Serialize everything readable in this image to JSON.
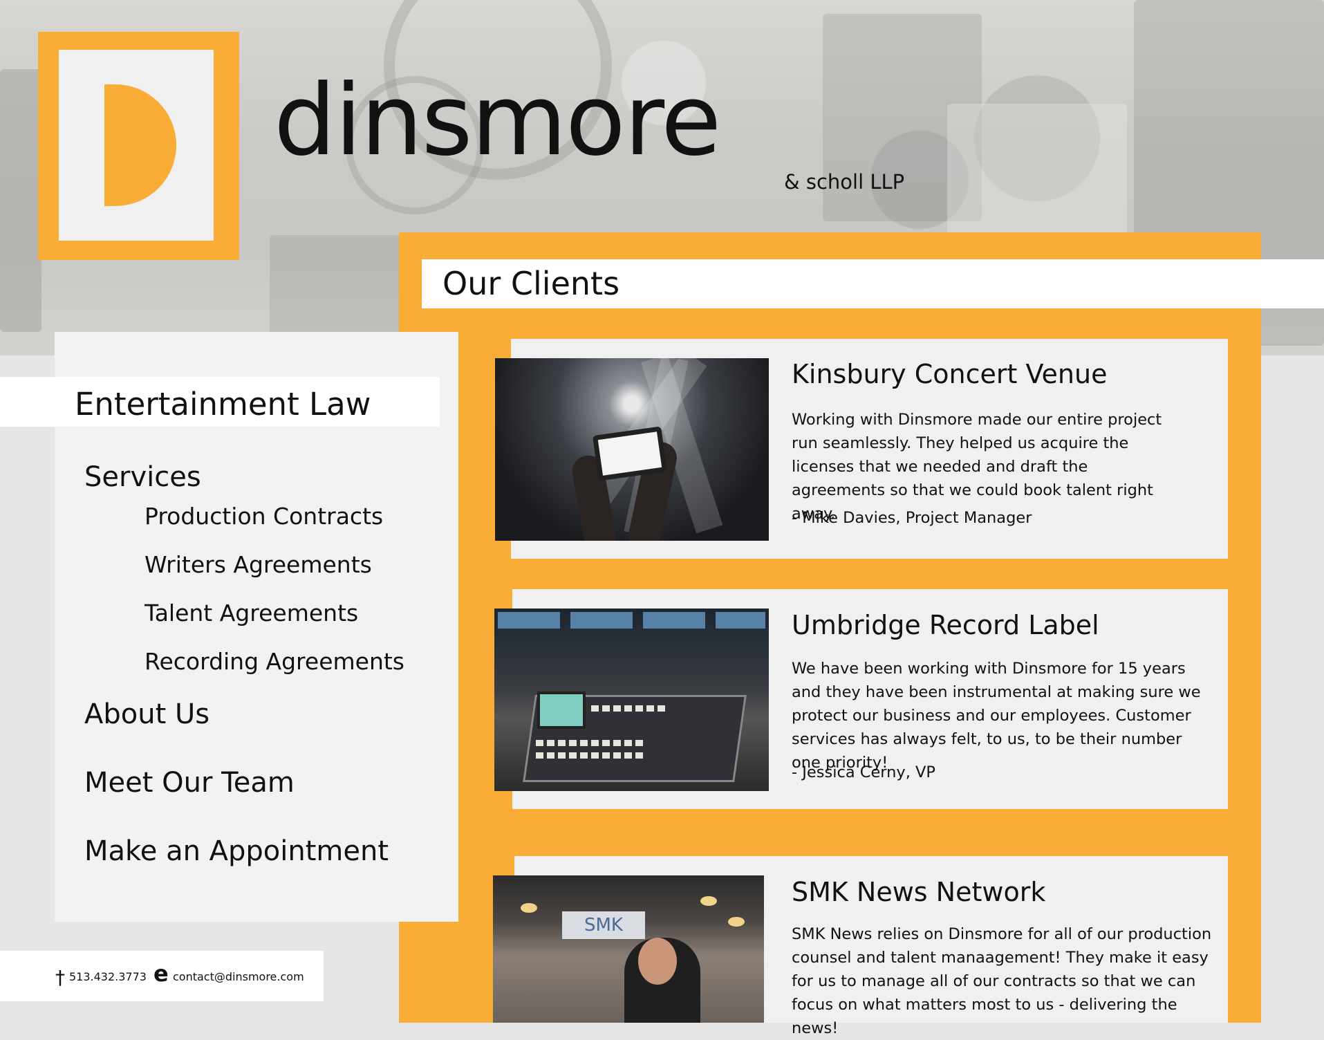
{
  "brand": {
    "logo_letter": "D",
    "name": "dinsmore",
    "suffix": "& scholl LLP",
    "accent_color": "#f9ad37"
  },
  "sidebar": {
    "category": "Entertainment Law",
    "services_label": "Services",
    "services": [
      "Production Contracts",
      "Writers Agreements",
      "Talent Agreements",
      "Recording Agreements"
    ],
    "links": [
      "About Us",
      "Meet Our Team",
      "Make an Appointment"
    ]
  },
  "contact": {
    "phone_icon": "phone-icon",
    "phone": "513.432.3773",
    "email_icon": "email-icon",
    "email": "contact@dinsmore.com"
  },
  "clients": {
    "title": "Our Clients",
    "items": [
      {
        "name": "Kinsbury Concert Venue",
        "quote": "Working with Dinsmore made our entire project run seamlessly. They helped us acquire the licenses that we needed and draft the agreements so that we could book talent right away.",
        "author": "- Mike Davies, Project Manager"
      },
      {
        "name": "Umbridge Record Label",
        "quote": "We have been working with Dinsmore for 15 years and they have been instrumental at making sure we protect our business and our employees. Customer services has always felt, to us, to be their number one priority!",
        "author": "- Jessica Cerny, VP"
      },
      {
        "name": "SMK News Network",
        "quote": "SMK News relies on Dinsmore for all of our production counsel and talent manaagement! They make it easy for us to manage all of our contracts so that we can focus on what matters most to us - delivering the news!",
        "sign_text": "SMK"
      }
    ]
  }
}
